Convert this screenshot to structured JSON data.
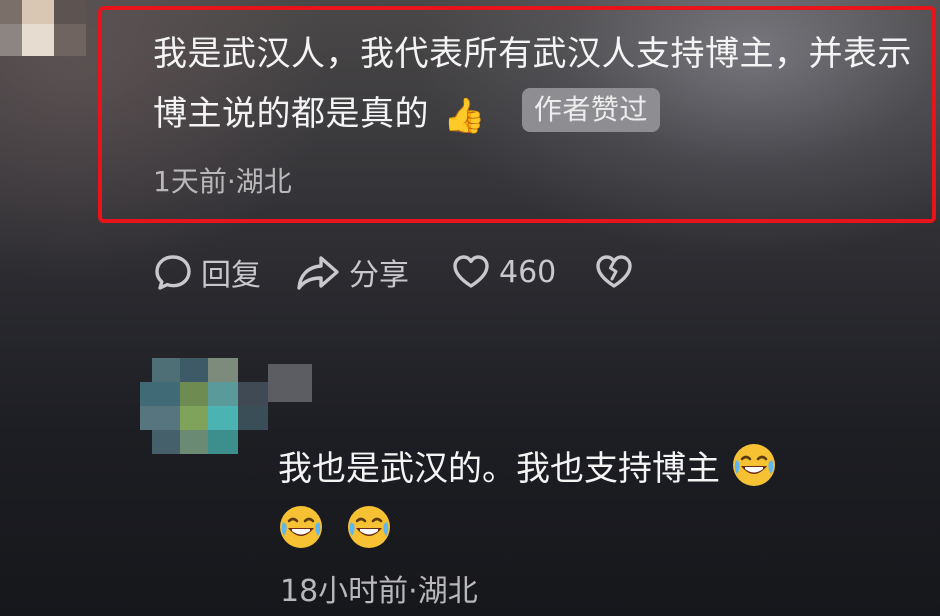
{
  "comment": {
    "text": "我是武汉人，我代表所有武汉人支持博主，并表示博主说的都是真的",
    "thumbs_emoji": "👍",
    "author_liked_tag": "作者赞过",
    "meta": "1天前·湖北"
  },
  "actions": {
    "reply_label": "回复",
    "share_label": "分享",
    "like_count": "460",
    "icons": [
      "comment-bubble-icon",
      "share-arrow-icon",
      "heart-icon",
      "broken-heart-icon"
    ]
  },
  "reply": {
    "text": "我也是武汉的。我也支持博主",
    "emoji_icon": "laugh-cry-emoji",
    "meta": "18小时前·湖北"
  },
  "colors": {
    "highlight_border": "#e8131b",
    "tag_background": "#8e8e92",
    "meta_text": "#b8b8ba"
  }
}
